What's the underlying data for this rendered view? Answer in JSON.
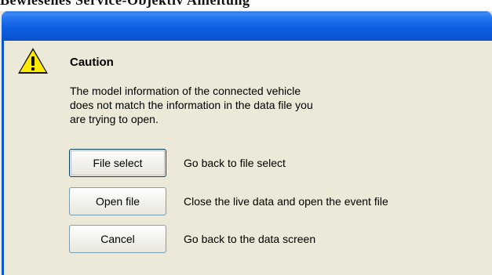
{
  "background_text": "Bewiesenes Service-Objektiv Anleitung",
  "dialog": {
    "caption": "Caution",
    "message_lines": [
      "The model information of the connected vehicle",
      "does not match the information in the data file you",
      "are trying to open."
    ],
    "icon": "warning-icon"
  },
  "buttons": [
    {
      "label": "File select",
      "description": "Go back to file select"
    },
    {
      "label": "Open file",
      "description": "Close the live data and open the event file"
    },
    {
      "label": "Cancel",
      "description": "Go back to the data screen"
    }
  ],
  "colors": {
    "title_bar": "#0b56d6",
    "dialog_bg": "#ece9d8",
    "warning_yellow": "#ffea00"
  }
}
